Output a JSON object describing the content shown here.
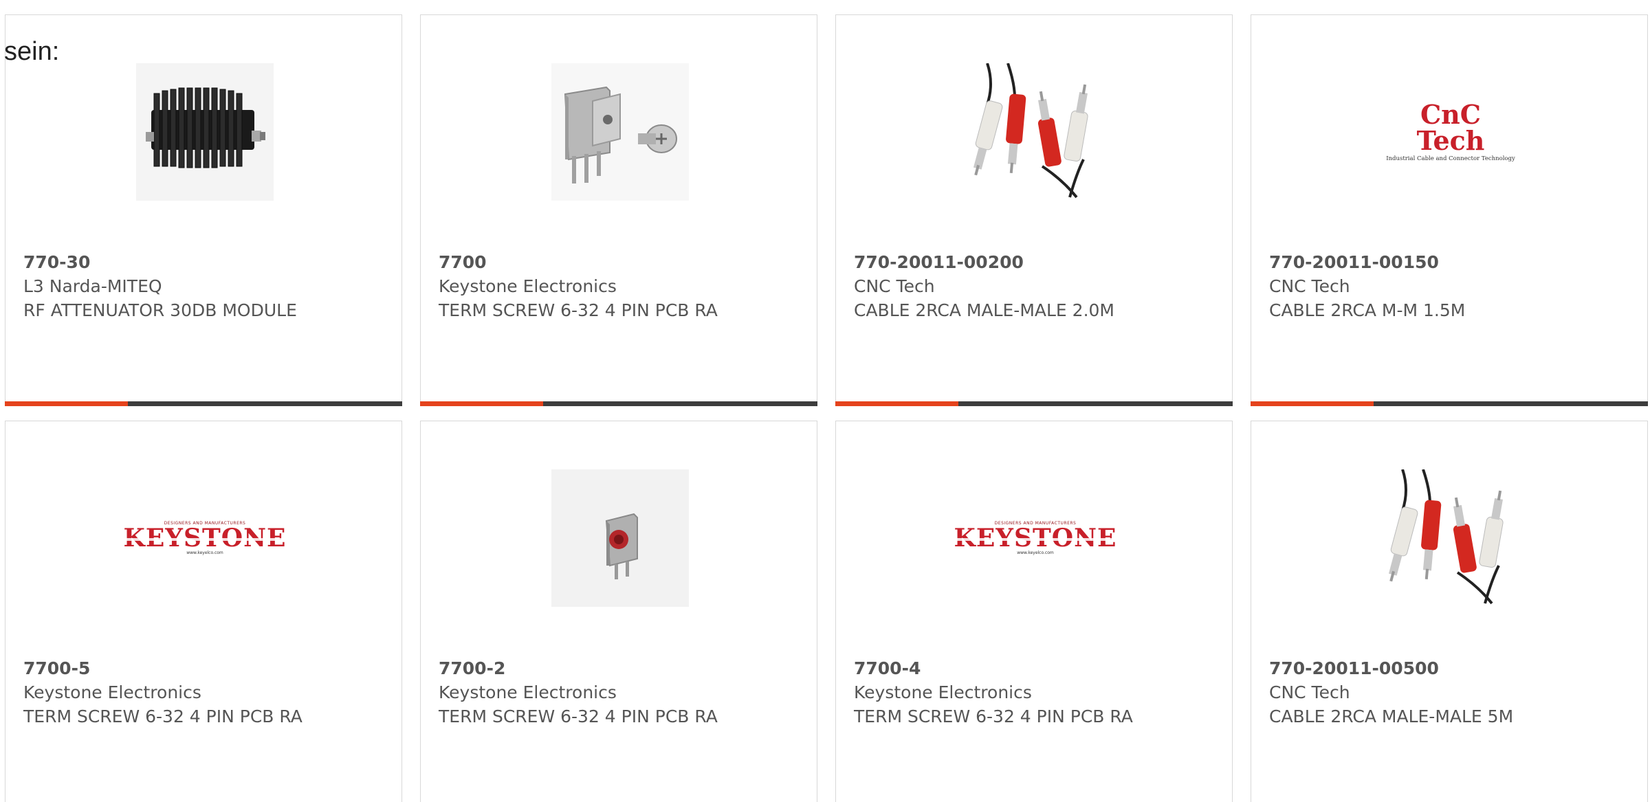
{
  "intro_text": "sein:",
  "colors": {
    "accent": "#e5431c",
    "bar_dark": "#3d3d3d",
    "card_border": "#d8d8d8",
    "text": "#555555",
    "logo_red": "#c8202a"
  },
  "products": [
    {
      "part_number": "770-30",
      "manufacturer": "L3 Narda-MITEQ",
      "description": "RF ATTENUATOR 30DB MODULE",
      "image": "rf-attenuator-photo",
      "progress": 0.31
    },
    {
      "part_number": "7700",
      "manufacturer": "Keystone Electronics",
      "description": "TERM SCREW 6-32 4 PIN PCB RA",
      "image": "terminal-screw-photo",
      "progress": 0.31
    },
    {
      "part_number": "770-20011-00200",
      "manufacturer": "CNC Tech",
      "description": "CABLE 2RCA MALE-MALE 2.0M",
      "image": "rca-cable-photo",
      "progress": 0.31
    },
    {
      "part_number": "770-20011-00150",
      "manufacturer": "CNC Tech",
      "description": "CABLE 2RCA M-M 1.5M",
      "image": "cnc-tech-logo",
      "logo_text": "CnC Tech",
      "logo_subtext": "Industrial Cable and Connector Technology",
      "progress": 0.31
    },
    {
      "part_number": "7700-5",
      "manufacturer": "Keystone Electronics",
      "description": "TERM SCREW 6-32 4 PIN PCB RA",
      "image": "keystone-logo",
      "logo_text": "KEYSTONE",
      "progress": 0.31
    },
    {
      "part_number": "7700-2",
      "manufacturer": "Keystone Electronics",
      "description": "TERM SCREW 6-32 4 PIN PCB RA",
      "image": "terminal-small-photo",
      "progress": 0.31
    },
    {
      "part_number": "7700-4",
      "manufacturer": "Keystone Electronics",
      "description": "TERM SCREW 6-32 4 PIN PCB RA",
      "image": "keystone-logo",
      "logo_text": "KEYSTONE",
      "progress": 0.31
    },
    {
      "part_number": "770-20011-00500",
      "manufacturer": "CNC Tech",
      "description": "CABLE 2RCA MALE-MALE 5M",
      "image": "rca-cable-photo",
      "progress": 0.31
    }
  ]
}
